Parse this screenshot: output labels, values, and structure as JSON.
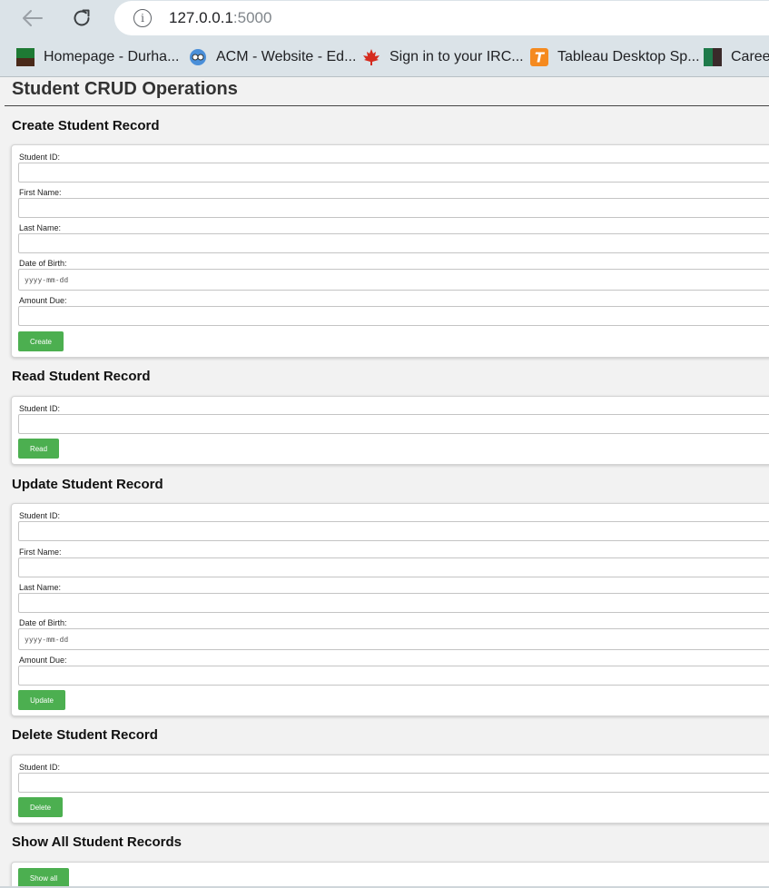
{
  "browser": {
    "url_host": "127.0.0.1",
    "url_port": ":5000",
    "bookmarks": [
      {
        "label": "Homepage - Durha...",
        "icon": "durham-icon"
      },
      {
        "label": "ACM - Website - Ed...",
        "icon": "acm-icon"
      },
      {
        "label": "Sign in to your IRC...",
        "icon": "maple-leaf-icon"
      },
      {
        "label": "Tableau Desktop Sp...",
        "icon": "tableau-icon"
      },
      {
        "label": "Career",
        "icon": "career-icon"
      }
    ]
  },
  "page": {
    "title": "Student CRUD Operations",
    "create": {
      "heading": "Create Student Record",
      "student_id_label": "Student ID:",
      "first_name_label": "First Name:",
      "last_name_label": "Last Name:",
      "dob_label": "Date of Birth:",
      "dob_placeholder": "yyyy-mm-dd",
      "amount_label": "Amount Due:",
      "button": "Create"
    },
    "read": {
      "heading": "Read Student Record",
      "student_id_label": "Student ID:",
      "button": "Read"
    },
    "update": {
      "heading": "Update Student Record",
      "student_id_label": "Student ID:",
      "first_name_label": "First Name:",
      "last_name_label": "Last Name:",
      "dob_label": "Date of Birth:",
      "dob_placeholder": "yyyy-mm-dd",
      "amount_label": "Amount Due:",
      "button": "Update"
    },
    "delete": {
      "heading": "Delete Student Record",
      "student_id_label": "Student ID:",
      "button": "Delete"
    },
    "show_all": {
      "heading": "Show All Student Records",
      "button": "Show all"
    }
  },
  "colors": {
    "button_green": "#4caf50",
    "page_background": "#f2f2f2",
    "chrome_background": "#dbe3e8"
  }
}
